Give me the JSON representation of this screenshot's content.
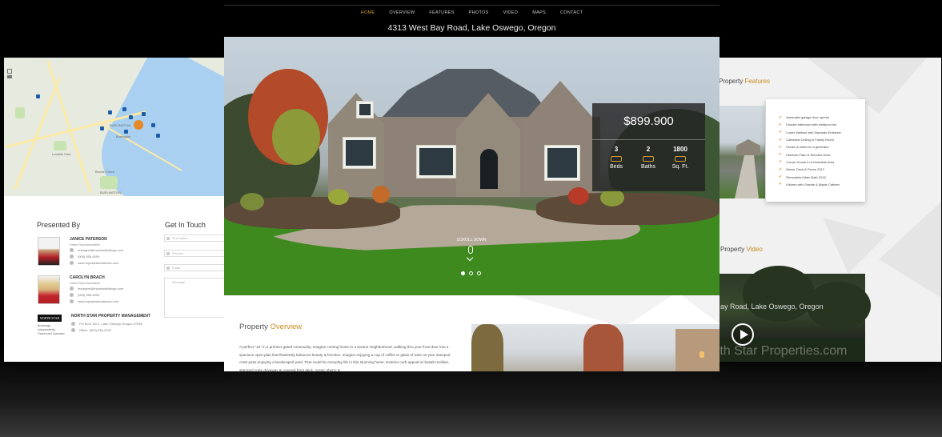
{
  "nav": {
    "items": [
      {
        "label": "HOME",
        "active": true
      },
      {
        "label": "OVERVIEW",
        "active": false
      },
      {
        "label": "FEATURES",
        "active": false
      },
      {
        "label": "PHOTOS",
        "active": false
      },
      {
        "label": "VIDEO",
        "active": false
      },
      {
        "label": "MAPS",
        "active": false
      },
      {
        "label": "CONTACT",
        "active": false
      }
    ],
    "active_color": "#d39a3b"
  },
  "address": "4313 West Bay Road, Lake Oswego, Oregon",
  "hero": {
    "price": "$899.900",
    "stats": [
      {
        "value": "3",
        "label": "Beds",
        "icon": "bed-icon"
      },
      {
        "value": "2",
        "label": "Baths",
        "icon": "bath-icon"
      },
      {
        "value": "1800",
        "label": "Sq. Ft.",
        "icon": "area-icon"
      }
    ],
    "scroll_label": "SCROLL DOWN",
    "slide_count": 3,
    "active_slide": 1
  },
  "overview": {
    "title_plain": "Property ",
    "title_accent": "Overview",
    "text": "A perfect \"10\" in a premier gated community. Imagine coming home to a serene neighborhood, walking thru your front door into a spacious open-plan that flawlessly balances beauty & function. Imagine enjoying a cup of coffee or glass of wine on your stamped crete patio enjoying a landscaped yard. That could be everyday life in this stunning home. Exterior curb appeal w/ basalt rockline, stamped crete driveway & covered front deck, scenic sherry &"
  },
  "left_panel": {
    "presented_by": "Presented By",
    "get_in_touch": "Get In Touch",
    "map_labels": [
      "BURLINGTON",
      "Burlington",
      "Lowville Park",
      "BURLINGTON",
      "Bronte Creek"
    ],
    "agents": [
      {
        "name": "JANICE PATERSON",
        "role": "Sales Representative",
        "email": "mvlagent@myvirtuallistings.com",
        "phone": "(905) 555-6390",
        "website": "www.mywebsiteaddress.com"
      },
      {
        "name": "CAROLYN BRACH",
        "role": "Sales Representative",
        "email": "mvlagent@myvirtuallistings.com",
        "phone": "(905) 555-6390",
        "website": "www.mywebsiteaddress.com"
      }
    ],
    "brokerage": {
      "logo_text": "NORTH STAR",
      "name": "NORTH STAR PROPERTY MANAGEMENT",
      "tagline": "Brokerage Independently Owned and Operated",
      "address": "PO BOX 1671, Lake Oswego Oregon 97035",
      "office": "Office: (503) 636-2232"
    },
    "form": {
      "first_name": "First Name",
      "phone": "Phone#",
      "email": "Email",
      "message": "Message"
    }
  },
  "right_panel": {
    "features_title_plain": "Property ",
    "features_title_accent": "Features",
    "features": [
      "Automatic garage door opener",
      "Ensuite bathroom with whirlpool tub",
      "Lower Walkout and Separate Entrance",
      "Cathedral Ceiling in Family Room",
      "House is wired for a generator",
      "Interlock Patio & Wooden Deck",
      "Corner House In A Desirable Area",
      "Newer Deck & Fence 2012",
      "Remodeled Main Bath 2016",
      "Kitchen with Granite & Maple Cabinet"
    ],
    "video_title_plain": "Property ",
    "video_title_accent": "Video",
    "video_caption": "ay Road, Lake Oswego, Oregon",
    "video_brand": "rth Star Properties.com"
  },
  "colors": {
    "accent": "#c8891f",
    "background": "#000000"
  }
}
